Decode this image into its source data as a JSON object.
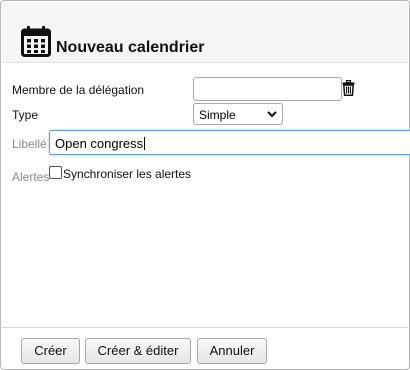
{
  "dialog": {
    "title": "Nouveau calendrier",
    "icon": "calendar-icon"
  },
  "form": {
    "member_label": "Membre de la délégation",
    "member_value": "",
    "delete_icon": "trash-icon",
    "type_label": "Type",
    "type_selected": "Simple",
    "libelle_label": "Libellé",
    "libelle_value": "Open congress",
    "alertes_label": "Alertes",
    "sync_label": "Synchroniser les alertes",
    "sync_checked": false
  },
  "buttons": {
    "create": "Créer",
    "create_edit": "Créer & éditer",
    "cancel": "Annuler"
  }
}
